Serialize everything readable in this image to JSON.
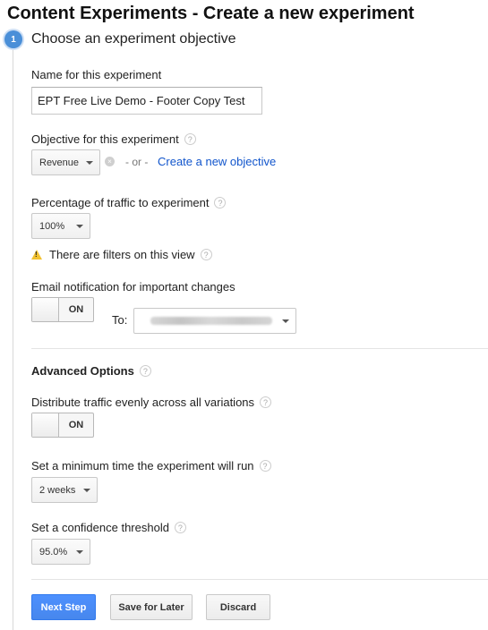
{
  "header": {
    "title": "Content Experiments - Create a new experiment"
  },
  "step": {
    "number": "1",
    "title": "Choose an experiment objective"
  },
  "name_field": {
    "label": "Name for this experiment",
    "value": "EPT Free Live Demo - Footer Copy Test"
  },
  "objective": {
    "label": "Objective for this experiment",
    "selected": "Revenue",
    "or_text": "- or -",
    "create_link": "Create a new objective"
  },
  "traffic": {
    "label": "Percentage of traffic to experiment",
    "selected": "100%",
    "warning": "There are filters on this view"
  },
  "email": {
    "label": "Email notification for important changes",
    "toggle_state": "ON",
    "to_label": "To:"
  },
  "advanced": {
    "heading": "Advanced Options",
    "distribute_label": "Distribute traffic evenly across all variations",
    "distribute_toggle": "ON",
    "min_time_label": "Set a minimum time the experiment will run",
    "min_time_selected": "2 weeks",
    "confidence_label": "Set a confidence threshold",
    "confidence_selected": "95.0%"
  },
  "buttons": {
    "next": "Next Step",
    "save": "Save for Later",
    "discard": "Discard"
  },
  "help_glyph": "?",
  "clear_glyph": "×",
  "warning_glyph": "!",
  "colors": {
    "primary_button": "#4d90fe",
    "link": "#1155cc",
    "step_badge": "#4a8fd8",
    "warning": "#f2c230"
  }
}
